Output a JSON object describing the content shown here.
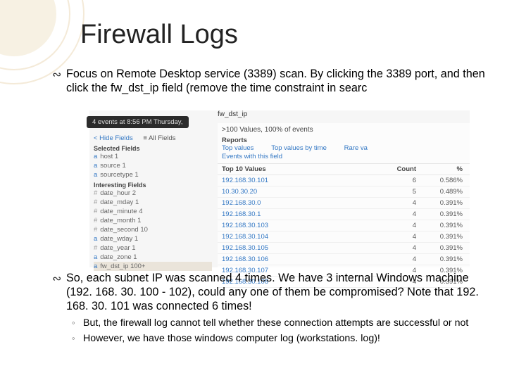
{
  "title": "Firewall Logs",
  "bullets": {
    "b1": "Focus on Remote Desktop service (3389) scan. By clicking the 3389 port, and then click the fw_dst_ip field (remove the time constraint in searc",
    "b2": "So, each subnet IP was scanned 4 times. We have 3 internal Windows machine (192. 168. 30. 100 - 102), could any one of them be compromised? Note that 192. 168. 30. 101 was connected 6 times!"
  },
  "subs": {
    "s1": "But, the firewall log cannot tell whether these connection attempts are successful or not",
    "s2": "However, we have those windows computer log (workstations. log)!"
  },
  "snap": {
    "bubble": "4 events at 8:56 PM Thursday,",
    "fieldname": "fw_dst_ip",
    "sel": "Sel",
    "topline": ">100 Values, 100% of events",
    "reports_hdr": "Reports",
    "links": {
      "top": "Top values",
      "time": "Top values by time",
      "rare": "Rare va",
      "events": "Events with this field"
    },
    "hide": "< Hide Fields",
    "allfields": "≡ All Fields",
    "selected_label": "Selected Fields",
    "selected": [
      {
        "p": "a",
        "n": "host 1"
      },
      {
        "p": "a",
        "n": "source 1"
      },
      {
        "p": "a",
        "n": "sourcetype 1"
      }
    ],
    "interesting_label": "Interesting Fields",
    "interesting": [
      {
        "p": "#",
        "n": "date_hour 2"
      },
      {
        "p": "#",
        "n": "date_mday 1"
      },
      {
        "p": "#",
        "n": "date_minute 4"
      },
      {
        "p": "#",
        "n": "date_month 1"
      },
      {
        "p": "#",
        "n": "date_second 10"
      },
      {
        "p": "a",
        "n": "date_wday 1"
      },
      {
        "p": "#",
        "n": "date_year 1"
      },
      {
        "p": "a",
        "n": "date_zone 1"
      },
      {
        "p": "a",
        "n": "fw_dst_ip 100+",
        "hl": true
      }
    ],
    "table": {
      "title": "Top 10 Values",
      "cols": [
        "Top 10 Values",
        "Count",
        "%"
      ],
      "rows": [
        {
          "ip": "192.168.30.101",
          "count": "6",
          "pct": "0.586%"
        },
        {
          "ip": "10.30.30.20",
          "count": "5",
          "pct": "0.489%"
        },
        {
          "ip": "192.168.30.0",
          "count": "4",
          "pct": "0.391%"
        },
        {
          "ip": "192.168.30.1",
          "count": "4",
          "pct": "0.391%"
        },
        {
          "ip": "192.168.30.103",
          "count": "4",
          "pct": "0.391%"
        },
        {
          "ip": "192.168.30.104",
          "count": "4",
          "pct": "0.391%"
        },
        {
          "ip": "192.168.30.105",
          "count": "4",
          "pct": "0.391%"
        },
        {
          "ip": "192.168.30.106",
          "count": "4",
          "pct": "0.391%"
        },
        {
          "ip": "192.168.30.107",
          "count": "4",
          "pct": "0.391%"
        },
        {
          "ip": "192.168.30.108",
          "count": "4",
          "pct": "0.391%"
        }
      ]
    }
  }
}
